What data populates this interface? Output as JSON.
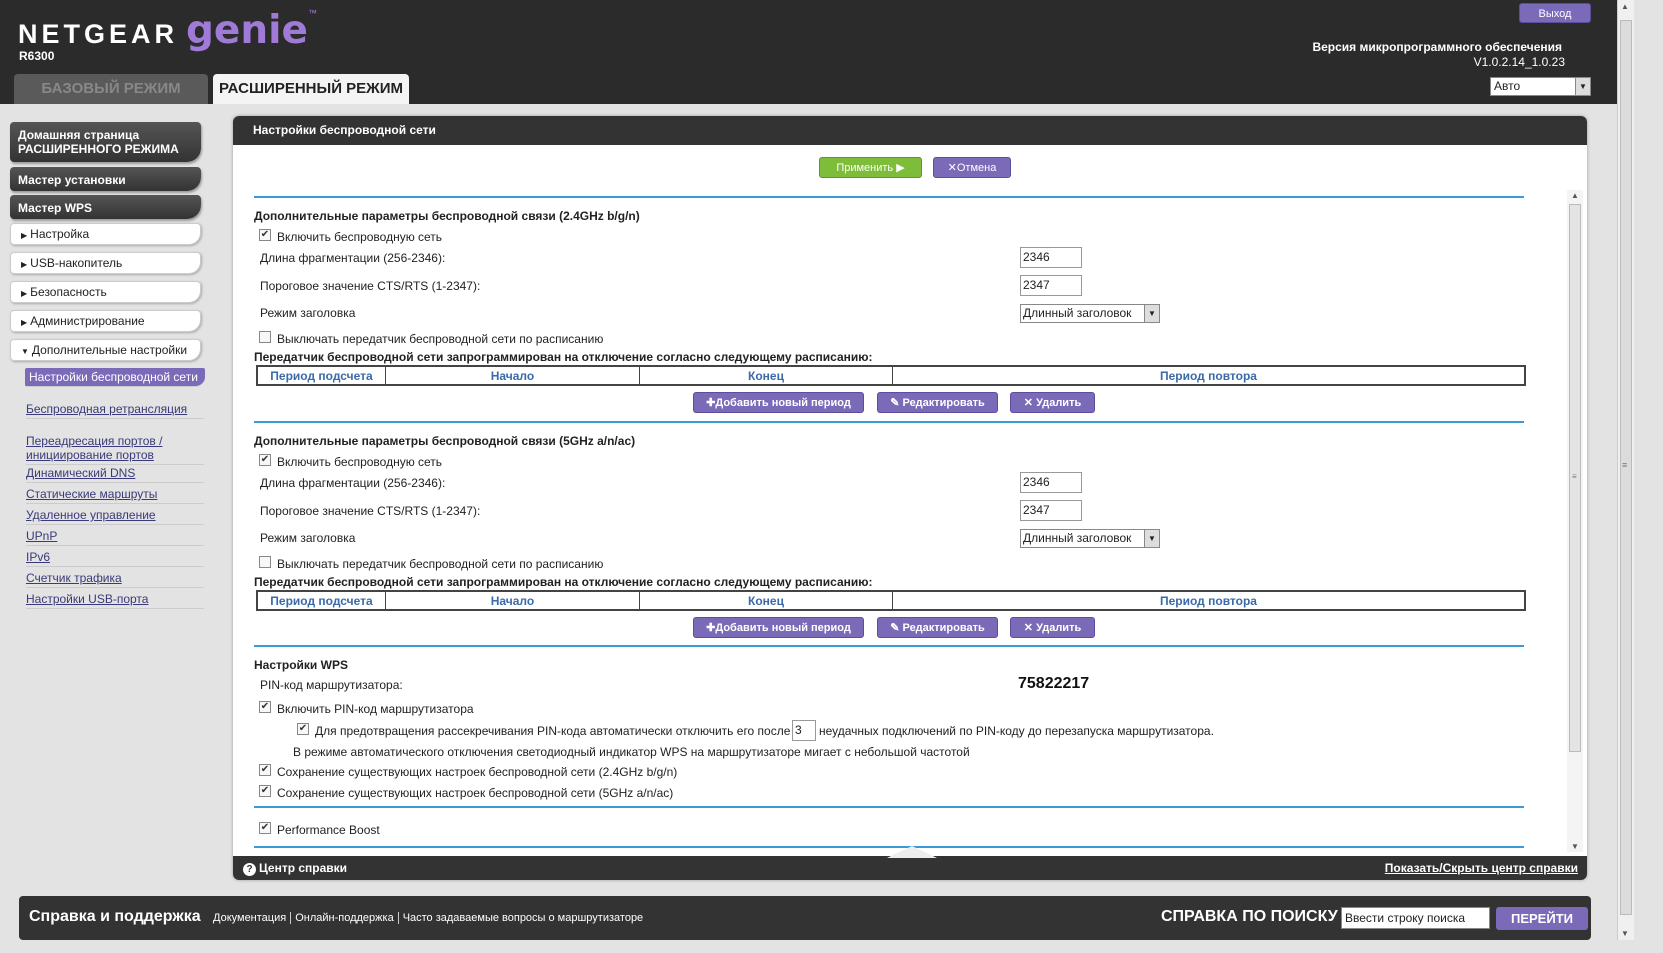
{
  "header": {
    "brand": "NETGEAR",
    "product": "genie",
    "trademark": "™",
    "model": "R6300",
    "tabs": [
      "БАЗОВЫЙ РЕЖИМ",
      "РАСШИРЕННЫЙ РЕЖИМ"
    ],
    "logout_label": "Выход",
    "firmware_label": "Версия микропрограммного обеспечения",
    "firmware_version": "V1.0.2.14_1.0.23",
    "language_value": "Авто"
  },
  "sidebar": {
    "main_buttons": [
      "Домашняя страница РАСШИРЕННОГО РЕЖИМА",
      "Мастер установки",
      "Мастер WPS"
    ],
    "sections": [
      "Настройка",
      "USB-накопитель",
      "Безопасность",
      "Администрирование",
      "Дополнительные настройки"
    ],
    "subitems": [
      "Настройки беспроводной сети",
      "Беспроводная ретрансляция",
      "Переадресация портов / инициирование портов",
      "Динамический DNS",
      "Статические маршруты",
      "Удаленное управление",
      "UPnP",
      "IPv6",
      "Счетчик трафика",
      "Настройки USB-порта"
    ]
  },
  "panel": {
    "title": "Настройки беспроводной сети",
    "apply_label": "Применить ▶",
    "cancel_label": "Отмена",
    "section24": {
      "title": "Дополнительные параметры беспроводной связи (2.4GHz b/g/n)",
      "enable_label": "Включить беспроводную сеть",
      "frag_label": "Длина фрагментации (256-2346):",
      "frag_value": "2346",
      "cts_label": "Пороговое значение CTS/RTS (1-2347):",
      "cts_value": "2347",
      "preamble_label": "Режим заголовка",
      "preamble_value": "Длинный заголовок",
      "schedule_label": "Выключать передатчик беспроводной сети по расписанию",
      "schedule_note": "Передатчик беспроводной сети запрограммирован на отключение согласно следующему расписанию:"
    },
    "section5": {
      "title": "Дополнительные параметры беспроводной связи (5GHz a/n/ac)",
      "enable_label": "Включить беспроводную сеть",
      "frag_label": "Длина фрагментации (256-2346):",
      "frag_value": "2346",
      "cts_label": "Пороговое значение CTS/RTS (1-2347):",
      "cts_value": "2347",
      "preamble_label": "Режим заголовка",
      "preamble_value": "Длинный заголовок",
      "schedule_label": "Выключать передатчик беспроводной сети по расписанию",
      "schedule_note": "Передатчик беспроводной сети запрограммирован на отключение согласно следующему расписанию:"
    },
    "table_headers": [
      "Период подсчета",
      "Начало",
      "Конец",
      "Период повтора"
    ],
    "add_period_label": "Добавить новый период",
    "edit_label": "Редактировать",
    "delete_label": "Удалить",
    "wps": {
      "title": "Настройки WPS",
      "pin_label": "PIN-код маршрутизатора:",
      "pin_value": "75822217",
      "enable_pin_label": "Включить PIN-код маршрутизатора",
      "prevent_before": "Для предотвращения рассекречивания PIN-кода автоматически отключить его после",
      "prevent_value": "3",
      "prevent_after": "неудачных подключений по PIN-коду до перезапуска маршрутизатора.",
      "led_note": "В режиме автоматического отключения светодиодный индикатор WPS на маршрутизаторе мигает с небольшой частотой",
      "keep24_label": "Сохранение существующих настроек беспроводной сети (2.4GHz b/g/n)",
      "keep5_label": "Сохранение существующих настроек беспроводной сети (5GHz a/n/ac)"
    },
    "performance_boost_label": "Performance Boost",
    "help_label": "Центр справки",
    "toggle_help_label": "Показать/Скрыть центр справки"
  },
  "footer": {
    "title": "Справка и поддержка",
    "links": [
      "Документация",
      "Онлайн-поддержка",
      "Часто задаваемые вопросы о маршрутизаторе"
    ],
    "search_title": "СПРАВКА ПО ПОИСКУ",
    "search_value": "Ввести строку поиска",
    "go_label": "ПЕРЕЙТИ"
  },
  "colors": {
    "accent_purple": "#7a6ab8",
    "apply_green": "#7dbd3a",
    "section_line_blue": "#3a9ad9",
    "header_dark": "#2b2b2b"
  },
  "checkbox_states": {
    "enable24": true,
    "schedule24": false,
    "enable5": true,
    "schedule5": false,
    "wps_pin": true,
    "wps_prevent": true,
    "keep24": true,
    "keep5": true,
    "performance_boost": true
  }
}
